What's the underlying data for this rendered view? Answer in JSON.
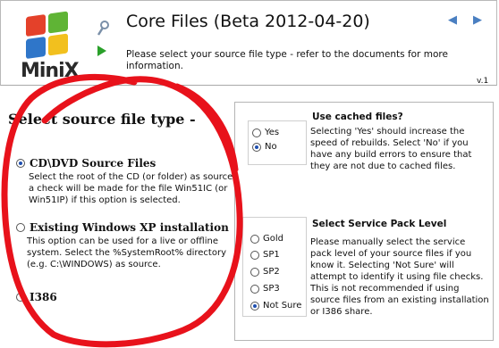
{
  "header": {
    "title": "Core Files (Beta 2012-04-20)",
    "subtitle": "Please select your source file type - refer to the documents for more information.",
    "version": "v.1",
    "logo_text": "MiniX",
    "nav_prev_glyph": "◀",
    "nav_next_glyph": "▶"
  },
  "source": {
    "heading": "Select source file type -",
    "options": [
      {
        "label": "CD\\DVD Source Files",
        "description": "Select the root of the CD (or folder) as source - a check will be made for the file Win51IC (or Win51IP) if this option is selected.",
        "selected": true
      },
      {
        "label": "Existing Windows XP installation",
        "description": "This option can be used for a live or offline system. Select the  %SystemRoot% directory (e.g. C:\\WINDOWS) as source.",
        "selected": false
      },
      {
        "label": "I386",
        "description": "",
        "selected": false
      }
    ]
  },
  "cached": {
    "title": "Use cached files?",
    "description": "Selecting 'Yes' should increase the speed of rebuilds. Select 'No' if you have any build errors to ensure that they are not due to cached files.",
    "options": [
      {
        "label": "Yes",
        "selected": false
      },
      {
        "label": "No",
        "selected": true
      }
    ]
  },
  "service_pack": {
    "title": "Select Service Pack Level",
    "description": "Please manually select the service pack level of your source files if you know it. Selecting 'Not Sure' will attempt to identify it using file checks. This is not recommended if using source files from an existing installation or I386 share.",
    "options": [
      {
        "label": "Gold",
        "selected": false
      },
      {
        "label": "SP1",
        "selected": false
      },
      {
        "label": "SP2",
        "selected": false
      },
      {
        "label": "SP3",
        "selected": false
      },
      {
        "label": "Not Sure",
        "selected": true
      }
    ]
  },
  "colors": {
    "annotation": "#e8121b",
    "accent": "#1f4fb0",
    "logo_red": "#e4412a",
    "logo_green": "#5fb435",
    "logo_blue": "#2f76c9",
    "logo_yellow": "#f2c01e"
  }
}
